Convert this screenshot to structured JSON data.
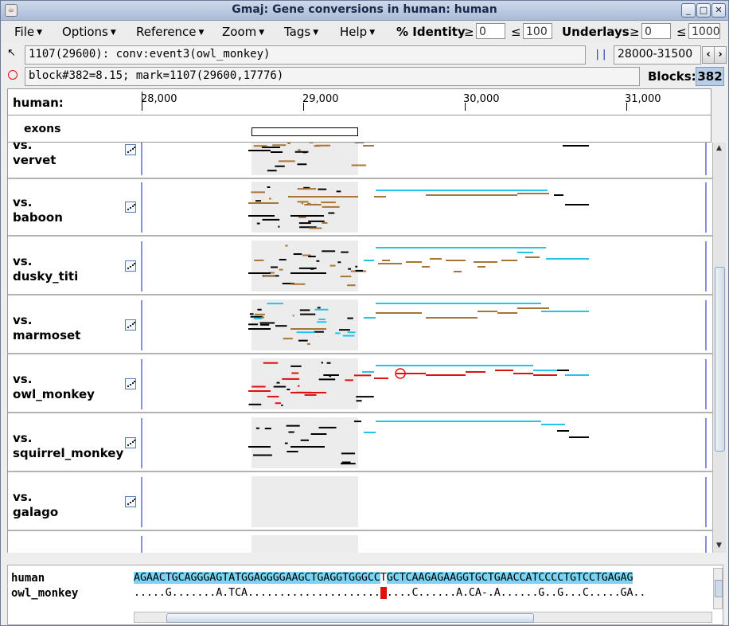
{
  "window": {
    "title": "Gmaj: Gene conversions in human: human"
  },
  "menubar": {
    "menus": [
      "File",
      "Options",
      "Reference",
      "Zoom",
      "Tags",
      "Help"
    ],
    "identity_label": "% Identity",
    "ge": "≥",
    "le": "≤",
    "identity_min": "0",
    "identity_max": "100",
    "underlays_label": "Underlays",
    "underlays_min": "0",
    "underlays_max": "1000"
  },
  "status": {
    "position_text": "1107(29600): conv:event3(owl_monkey)",
    "range_text": "28000-31500",
    "block_text": "block#382=8.15; mark=1107(29600,17776)",
    "blocks_label": "Blocks:",
    "blocks_value": "382"
  },
  "ruler": {
    "reference": "human:",
    "ticks": [
      "28,000",
      "29,000",
      "30,000",
      "31,000"
    ]
  },
  "exons_label": "exons",
  "tracks": [
    {
      "prefix": "vs.",
      "name": "vervet"
    },
    {
      "prefix": "vs.",
      "name": "baboon"
    },
    {
      "prefix": "vs.",
      "name": "dusky_titi"
    },
    {
      "prefix": "vs.",
      "name": "marmoset"
    },
    {
      "prefix": "vs.",
      "name": "owl_monkey"
    },
    {
      "prefix": "vs.",
      "name": "squirrel_monkey"
    },
    {
      "prefix": "vs.",
      "name": "galago"
    }
  ],
  "colors": {
    "cyan": "#22c5ea",
    "brown": "#a87535",
    "red": "#dd1111",
    "black": "#000000",
    "shade": "#ececec",
    "axis": "#1a1acc"
  },
  "sequence": {
    "ref_name": "human",
    "ref_before": "AGAACTGCAGGGAGTATGGAGGGGAAGCTGAGGTGGGCC",
    "ref_mark": "T",
    "ref_after": "GCTCAAGAGAAGGTGCTGAACCATCCCCTGTCCTGAGAG",
    "cmp_name": "owl_monkey",
    "cmp_before": ".....G.......A.TCA.....................",
    "cmp_mark": " ",
    "cmp_after": "....C......A.CA-.A......G..G...C.....GA.."
  }
}
